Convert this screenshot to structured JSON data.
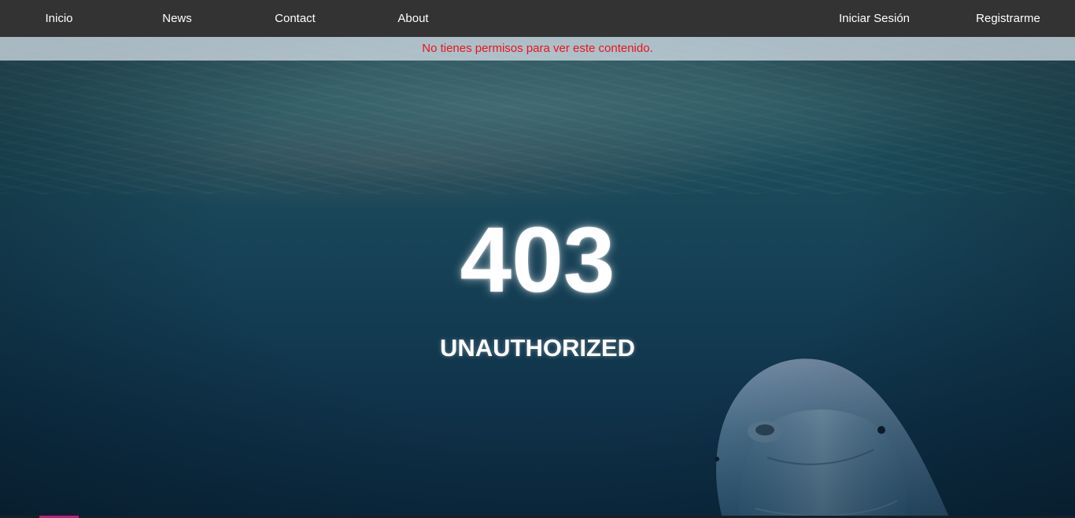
{
  "nav": {
    "inicio": "Inicio",
    "news": "News",
    "contact": "Contact",
    "about": "About",
    "login": "Iniciar Sesión",
    "register": "Registrarme"
  },
  "alert": {
    "text": "No tienes permisos para ver este contenido.",
    "color": "#e8141e"
  },
  "error": {
    "code": "403",
    "message": "UNAUTHORIZED"
  },
  "colors": {
    "navbar": "#333333",
    "text": "#ffffff"
  },
  "background": {
    "icon": "underwater-dolphin-image"
  }
}
